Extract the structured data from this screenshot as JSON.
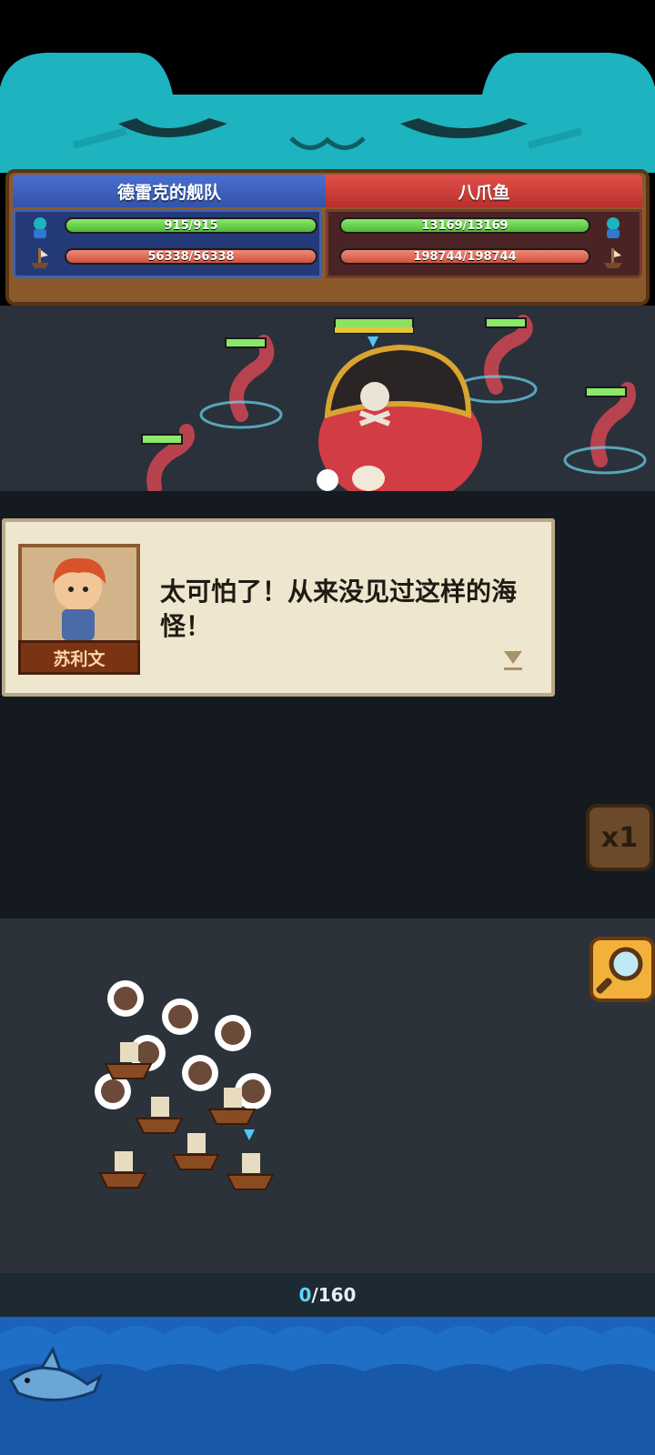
{
  "teams": {
    "left": {
      "name": "德雷克的舰队",
      "crew": "915/915",
      "hull": "56338/56338"
    },
    "right": {
      "name": "八爪鱼",
      "crew": "13169/13169",
      "hull": "198744/198744"
    }
  },
  "dialog": {
    "speaker": "苏利文",
    "text": "太可怕了！从来没见过这样的海怪！"
  },
  "controls": {
    "speed": "x1"
  },
  "counter": {
    "current": "0",
    "total": "/160"
  },
  "colors": {
    "accent_teal": "#1db3bf",
    "hp_green": "#5ccc45",
    "hp_red": "#e05a48",
    "left_team": "#3a5bb8",
    "right_team": "#d0403a"
  }
}
